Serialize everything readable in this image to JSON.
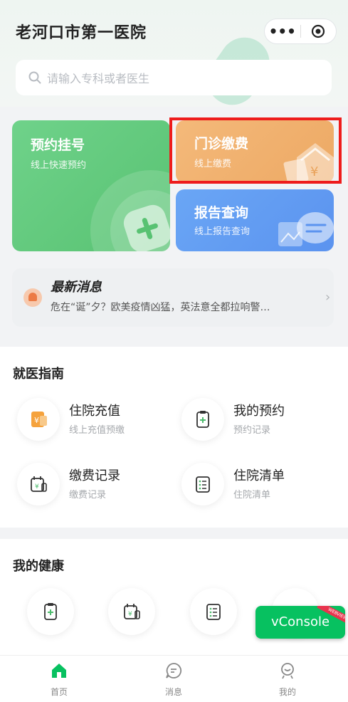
{
  "app": {
    "title": "老河口市第一医院",
    "capsule_more": "•••"
  },
  "search": {
    "placeholder": "请输入专科或者医生"
  },
  "cards": {
    "register": {
      "title": "预约挂号",
      "subtitle": "线上快速预约"
    },
    "payment": {
      "title": "门诊缴费",
      "subtitle": "线上缴费"
    },
    "report": {
      "title": "报告查询",
      "subtitle": "线上报告查询"
    }
  },
  "news": {
    "title": "最新消息",
    "text": "危在“诞”夕？欧美疫情凶猛，英法意全都拉响警…"
  },
  "guide": {
    "title": "就医指南",
    "items": [
      {
        "label": "住院充值",
        "sub": "线上充值预缴",
        "icon": "wallet-yuan-icon"
      },
      {
        "label": "我的预约",
        "sub": "预约记录",
        "icon": "clipboard-plus-icon"
      },
      {
        "label": "缴费记录",
        "sub": "缴费记录",
        "icon": "calendar-yuan-icon"
      },
      {
        "label": "住院清单",
        "sub": "住院清单",
        "icon": "checklist-icon"
      }
    ]
  },
  "health": {
    "title": "我的健康",
    "icons": [
      "clipboard-plus-icon",
      "calendar-yuan-icon",
      "checklist-icon"
    ]
  },
  "vconsole": {
    "label": "vConsole",
    "ribbon": "WEBVIEW"
  },
  "tabbar": {
    "items": [
      {
        "label": "首页",
        "icon": "home-icon"
      },
      {
        "label": "消息",
        "icon": "message-icon"
      },
      {
        "label": "我的",
        "icon": "profile-icon"
      }
    ]
  },
  "colors": {
    "accent_green": "#58c272",
    "payment_orange": "#eda964",
    "report_blue": "#5b93ef",
    "highlight_red": "#ee1c1c"
  }
}
